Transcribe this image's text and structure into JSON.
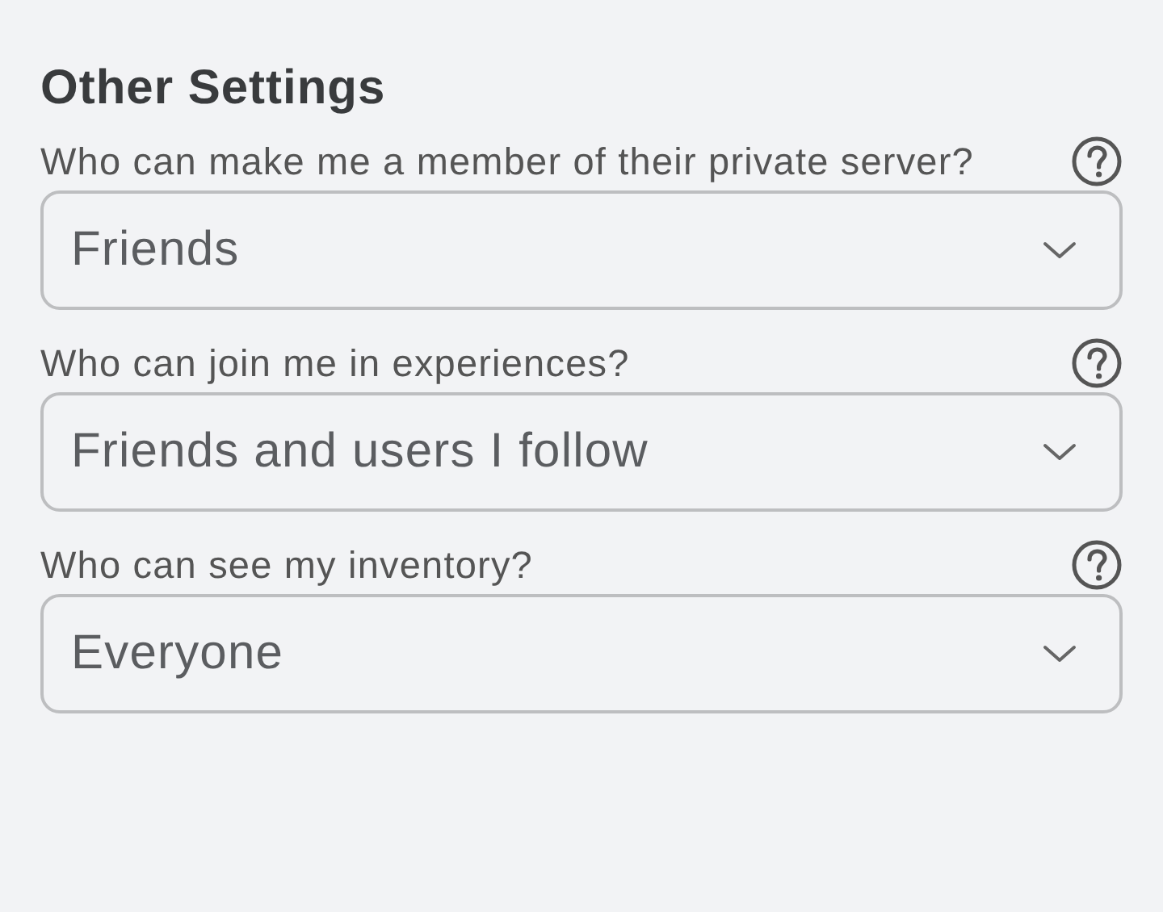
{
  "title": "Other Settings",
  "settings": [
    {
      "question": "Who can make me a member of their private server?",
      "value": "Friends"
    },
    {
      "question": "Who can join me in experiences?",
      "value": "Friends and users I follow"
    },
    {
      "question": "Who can see my inventory?",
      "value": "Everyone"
    }
  ]
}
